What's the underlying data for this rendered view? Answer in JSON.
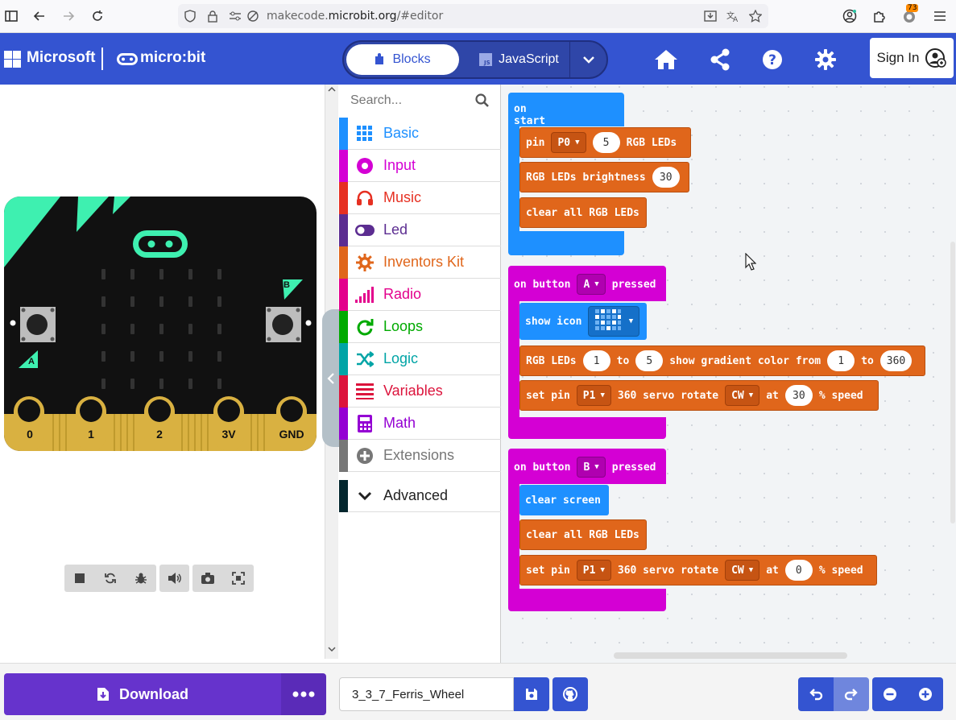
{
  "browser": {
    "url_prefix": "makecode.",
    "url_domain": "microbit.org",
    "url_suffix": "/#editor",
    "extensions_badge": "73"
  },
  "header": {
    "brand": "Microsoft",
    "product": "micro:bit",
    "tab_blocks": "Blocks",
    "tab_javascript": "JavaScript",
    "sign_in": "Sign In"
  },
  "toolbox": {
    "search_placeholder": "Search...",
    "categories": [
      {
        "label": "Basic",
        "color": "#1e90ff"
      },
      {
        "label": "Input",
        "color": "#d400d4"
      },
      {
        "label": "Music",
        "color": "#e63022"
      },
      {
        "label": "Led",
        "color": "#5c2d91"
      },
      {
        "label": "Inventors Kit",
        "color": "#e0661b"
      },
      {
        "label": "Radio",
        "color": "#e3008c"
      },
      {
        "label": "Loops",
        "color": "#00aa00"
      },
      {
        "label": "Logic",
        "color": "#00a4a6"
      },
      {
        "label": "Variables",
        "color": "#dc143c"
      },
      {
        "label": "Math",
        "color": "#9400d3"
      },
      {
        "label": "Extensions",
        "color": "#777777"
      }
    ],
    "advanced": "Advanced"
  },
  "simulator": {
    "pins": [
      "0",
      "1",
      "2",
      "3V",
      "GND"
    ],
    "button_a": "A",
    "button_b": "B"
  },
  "blocks": {
    "on_start": {
      "hat": "on start",
      "pin_label": "pin",
      "pin_value": "P0",
      "led_count": "5",
      "rgb_leds": "RGB LEDs",
      "brightness_label": "RGB LEDs brightness",
      "brightness_value": "30",
      "clear_label": "clear all RGB LEDs"
    },
    "on_button_a": {
      "hat_prefix": "on button",
      "button": "A",
      "hat_suffix": "pressed",
      "show_icon": "show icon",
      "gradient_prefix": "RGB LEDs",
      "gradient_from_led": "1",
      "to1": "to",
      "gradient_to_led": "5",
      "gradient_mid": "show gradient color from",
      "hue_from": "1",
      "to2": "to",
      "hue_to": "360",
      "servo_prefix": "set pin",
      "servo_pin": "P1",
      "servo_mid": "360 servo rotate",
      "direction": "CW",
      "at": "at",
      "speed": "30",
      "speed_suffix": "% speed"
    },
    "on_button_b": {
      "hat_prefix": "on button",
      "button": "B",
      "hat_suffix": "pressed",
      "clear_screen": "clear screen",
      "clear_leds": "clear all RGB LEDs",
      "servo_prefix": "set pin",
      "servo_pin": "P1",
      "servo_mid": "360 servo rotate",
      "direction": "CW",
      "at": "at",
      "speed": "0",
      "speed_suffix": "% speed"
    }
  },
  "bottom": {
    "download": "Download",
    "project_name": "3_3_7_Ferris_Wheel"
  },
  "colors": {
    "header": "#3454d1",
    "download": "#6633cc",
    "block_orange": "#e0661b",
    "block_blue": "#1e90ff",
    "block_magenta": "#d400d4",
    "board_accent": "#3ef0b0",
    "board_gold": "#d9b141"
  }
}
